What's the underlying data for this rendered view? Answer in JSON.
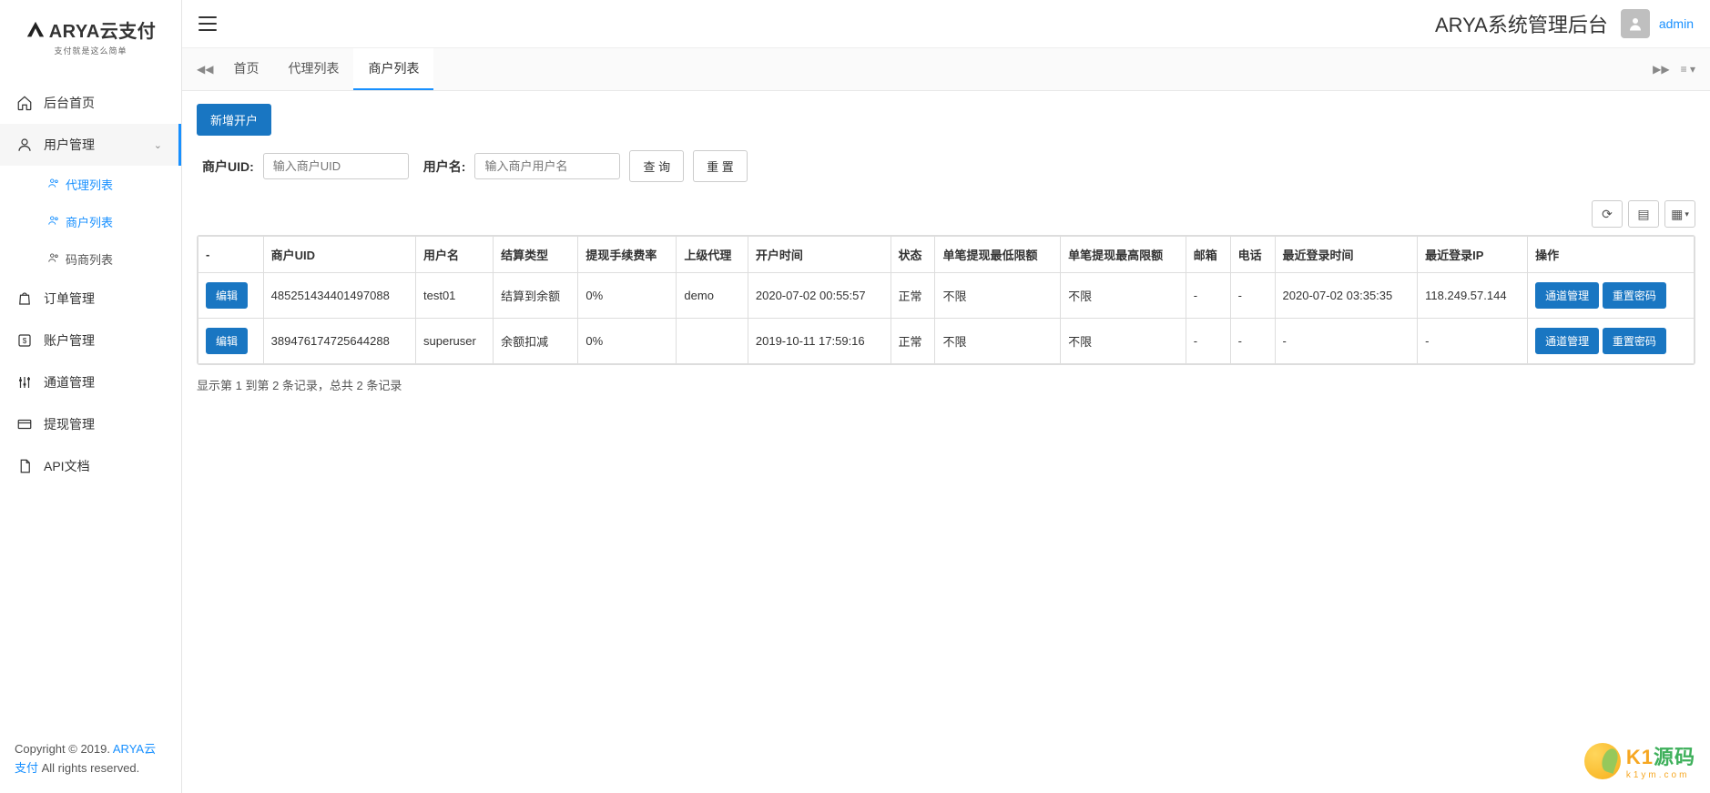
{
  "brand": {
    "name": "ARYA云支付",
    "tagline": "支付就是这么简单"
  },
  "header": {
    "system_title": "ARYA系统管理后台",
    "user": "admin"
  },
  "nav": {
    "items": [
      {
        "icon": "home",
        "label": "后台首页",
        "expandable": false
      },
      {
        "icon": "user",
        "label": "用户管理",
        "expandable": true,
        "active": true
      },
      {
        "icon": "bag",
        "label": "订单管理",
        "expandable": false
      },
      {
        "icon": "dollar",
        "label": "账户管理",
        "expandable": false
      },
      {
        "icon": "sliders",
        "label": "通道管理",
        "expandable": false
      },
      {
        "icon": "withdraw",
        "label": "提现管理",
        "expandable": false
      },
      {
        "icon": "doc",
        "label": "API文档",
        "expandable": false
      }
    ],
    "sub_items": [
      {
        "label": "代理列表",
        "muted": false
      },
      {
        "label": "商户列表",
        "muted": false
      },
      {
        "label": "码商列表",
        "muted": true
      }
    ]
  },
  "footer": {
    "copyright_prefix": "Copyright © 2019. ",
    "brand_link": "ARYA云支付",
    "suffix": " All rights reserved."
  },
  "tabs": {
    "items": [
      "首页",
      "代理列表",
      "商户列表"
    ],
    "active_index": 2
  },
  "actions": {
    "add": "新增开户",
    "query": "查 询",
    "reset": "重 置"
  },
  "filters": {
    "uid_label": "商户UID:",
    "uid_placeholder": "输入商户UID",
    "username_label": "用户名:",
    "username_placeholder": "输入商户用户名"
  },
  "table": {
    "columns": [
      "-",
      "商户UID",
      "用户名",
      "结算类型",
      "提现手续费率",
      "上级代理",
      "开户时间",
      "状态",
      "单笔提现最低限额",
      "单笔提现最高限额",
      "邮箱",
      "电话",
      "最近登录时间",
      "最近登录IP",
      "操作"
    ],
    "edit_label": "编辑",
    "row_actions": [
      "通道管理",
      "重置密码"
    ],
    "rows": [
      {
        "uid": "485251434401497088",
        "username": "test01",
        "settle": "结算到余额",
        "fee": "0%",
        "agent": "demo",
        "open_time": "2020-07-02 00:55:57",
        "status": "正常",
        "min": "不限",
        "max": "不限",
        "email": "-",
        "phone": "-",
        "last_login": "2020-07-02 03:35:35",
        "last_ip": "118.249.57.144"
      },
      {
        "uid": "389476174725644288",
        "username": "superuser",
        "settle": "余额扣减",
        "fee": "0%",
        "agent": "",
        "open_time": "2019-10-11 17:59:16",
        "status": "正常",
        "min": "不限",
        "max": "不限",
        "email": "-",
        "phone": "-",
        "last_login": "-",
        "last_ip": "-"
      }
    ]
  },
  "summary": "显示第 1 到第 2 条记录，总共 2 条记录",
  "watermark": {
    "main_a": "K1",
    "main_b": "源码",
    "sub": "k1ym.com"
  }
}
